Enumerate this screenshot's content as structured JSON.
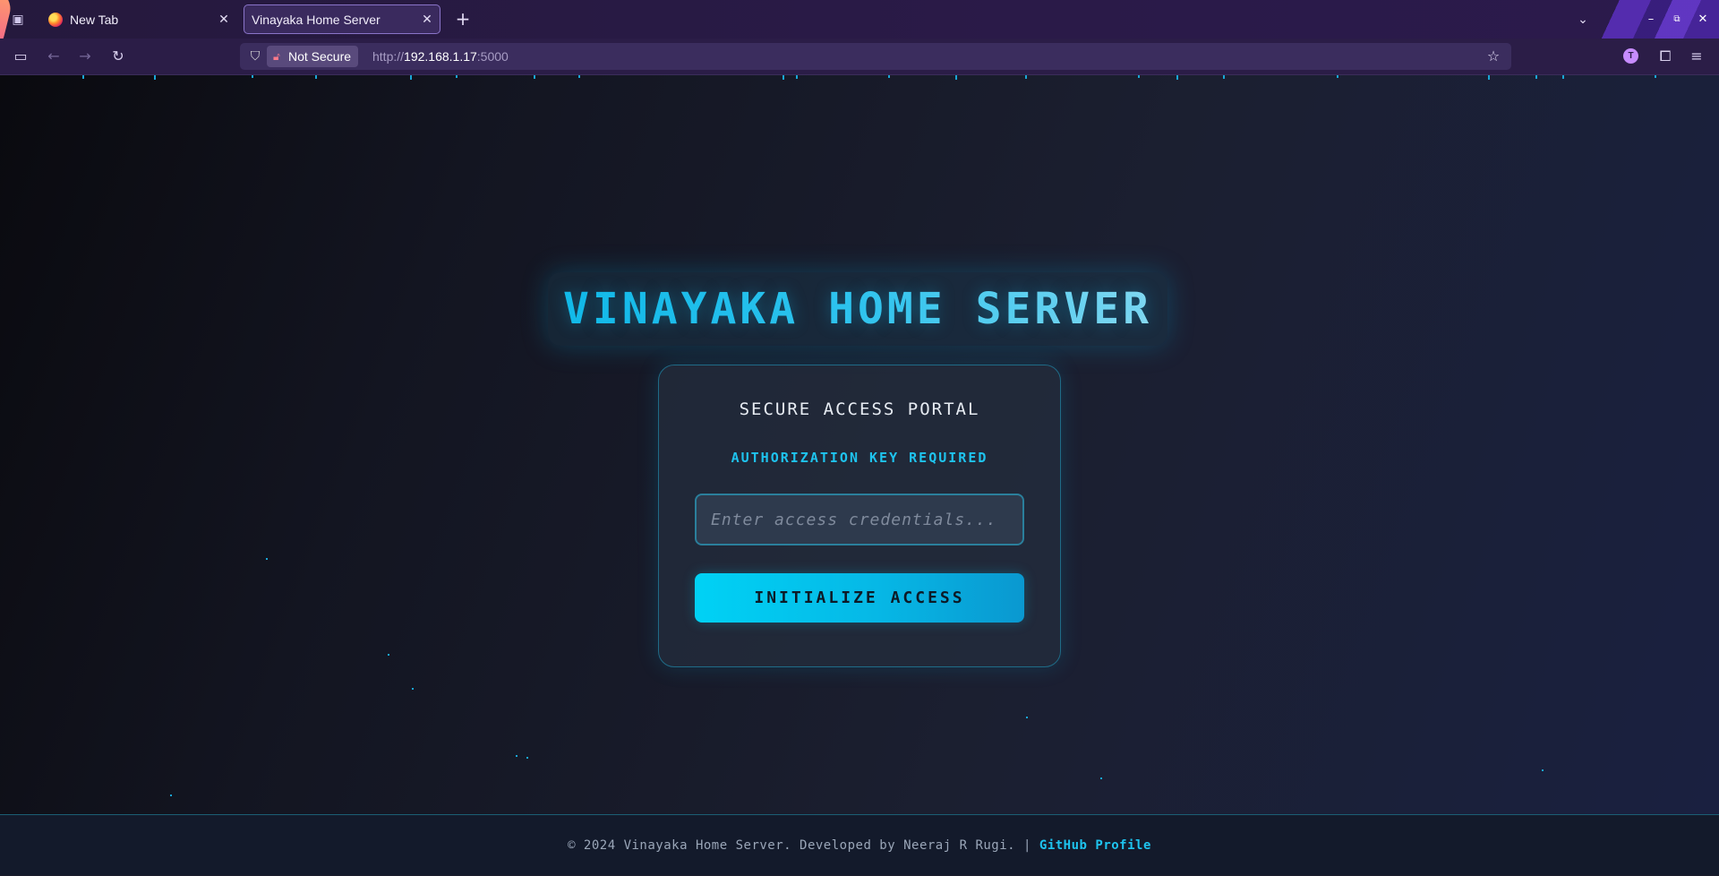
{
  "browser": {
    "tabs": [
      {
        "title": "New Tab",
        "active": false
      },
      {
        "title": "Vinayaka Home Server",
        "active": true
      }
    ],
    "close_glyph": "✕",
    "new_tab_glyph": "+",
    "url": {
      "security_label": "Not Secure",
      "scheme": "http://",
      "host": "192.168.1.17",
      "port": ":5000"
    },
    "profile_initial": "T"
  },
  "page": {
    "title": "VINAYAKA HOME SERVER",
    "portal_title": "SECURE ACCESS PORTAL",
    "auth_label": "AUTHORIZATION KEY REQUIRED",
    "input_placeholder": "Enter access credentials...",
    "submit_label": "INITIALIZE ACCESS"
  },
  "footer": {
    "text": "© 2024 Vinayaka Home Server. Developed by Neeraj R Rugi. |",
    "link_label": "GitHub Profile"
  },
  "colors": {
    "accent": "#1ec3ee",
    "button_gradient_start": "#00d2f5",
    "button_gradient_end": "#0a98d0",
    "browser_chrome": "#2b1d47",
    "page_background": "#1b1f30"
  }
}
